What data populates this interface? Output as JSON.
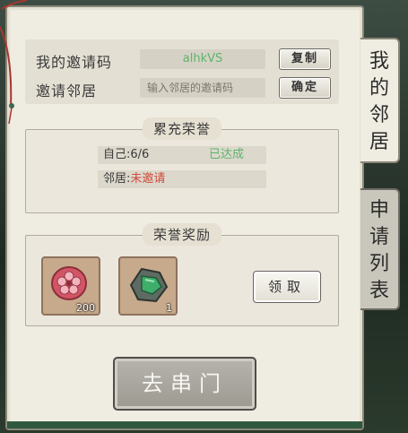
{
  "invite": {
    "my_code_label": "我的邀请码",
    "my_code_value": "alhkVS",
    "copy_button": "复制",
    "invite_label": "邀请邻居",
    "invite_placeholder": "输入邻居的邀请码",
    "confirm_button": "确定"
  },
  "honor": {
    "title": "累充荣誉",
    "self_label": "自己:6/6",
    "self_status": "已达成",
    "neighbor_label": "邻居:",
    "neighbor_status": "未邀请"
  },
  "reward": {
    "title": "荣誉奖励",
    "items": [
      {
        "icon": "plum-blossom-token-icon",
        "count": "200"
      },
      {
        "icon": "jade-stone-icon",
        "count": "1"
      }
    ],
    "claim_button": "领取"
  },
  "go_button": "去串门",
  "tabs": [
    {
      "label_chars": [
        "我",
        "的",
        "邻",
        "居"
      ],
      "active": true
    },
    {
      "label_chars": [
        "申",
        "请",
        "列",
        "表"
      ],
      "active": false
    }
  ],
  "colors": {
    "green_text": "#5bb56a",
    "red_text": "#d24a3b",
    "panel_bg": "#efece2"
  }
}
